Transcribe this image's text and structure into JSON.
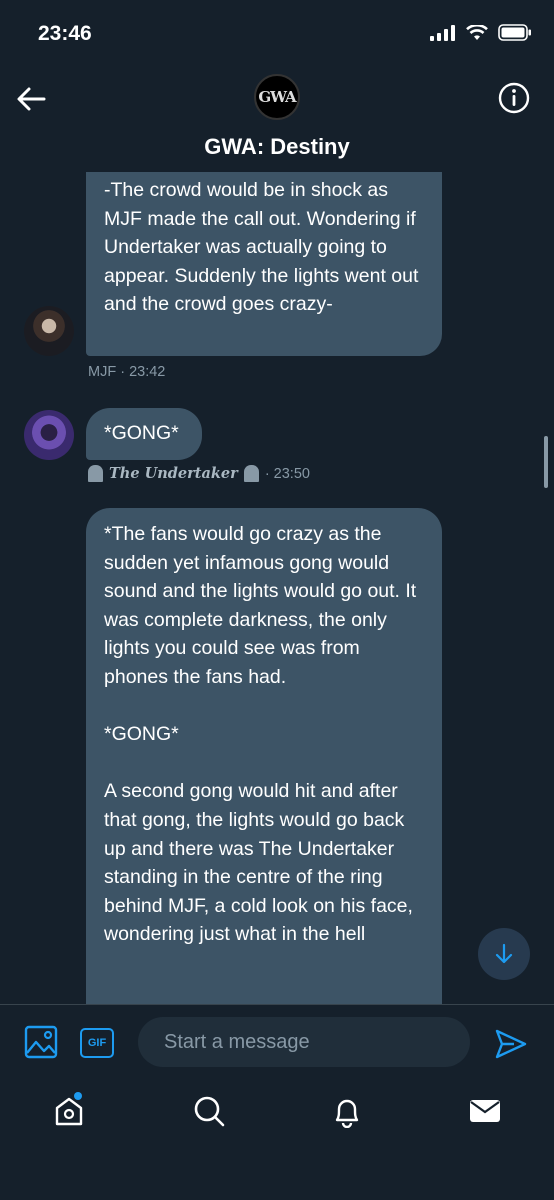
{
  "status_bar": {
    "time": "23:46"
  },
  "header": {
    "title": "GWA: Destiny",
    "avatar_text": "GWA"
  },
  "messages": [
    {
      "text": "-The crowd would be in shock as MJF made the call out. Wondering if Undertaker was actually going to appear. Suddenly the lights went out and the crowd goes crazy-",
      "sender": "MJF",
      "time": "· 23:42"
    },
    {
      "text": "*GONG*",
      "sender": "The Undertaker",
      "time": "· 23:50"
    },
    {
      "text": "*The fans would go crazy as the sudden yet infamous gong would sound and the lights would go out. It was complete darkness, the only lights you could see was from phones the fans had.\n\n*GONG*\n\nA second gong would hit and after that gong, the lights would go back up and there was The Undertaker standing in the centre of the ring behind MJF, a cold look on his face, wondering just what in the hell"
    }
  ],
  "composer": {
    "gif_label": "GIF",
    "placeholder": "Start a message"
  },
  "colors": {
    "accent": "#1d9bf0",
    "background": "#15202b",
    "bubble": "#3d5466"
  }
}
